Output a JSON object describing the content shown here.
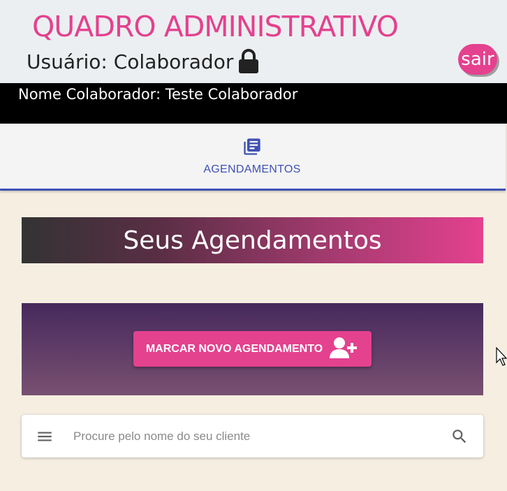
{
  "header": {
    "title": "QUADRO ADMINISTRATIVO",
    "user_label": "Usuário: Colaborador",
    "lock_icon": "lock-icon",
    "logout_label": "sair"
  },
  "collaborator": {
    "name_line": "Nome Colaborador: Teste Colaborador"
  },
  "tabs": [
    {
      "label": "AGENDAMENTOS",
      "icon": "library-books-icon",
      "active": true
    }
  ],
  "main": {
    "section_title": "Seus Agendamentos",
    "new_appointment_label": "MARCAR NOVO AGENDAMENTO",
    "new_appointment_icon": "person-add-icon"
  },
  "search": {
    "placeholder": "Procure pelo nome do seu cliente",
    "value": "",
    "menu_icon": "menu-icon",
    "search_icon": "search-icon"
  },
  "colors": {
    "brand_pink": "#e4418f",
    "tab_accent": "#3f51b5",
    "page_background": "#f6efe1"
  }
}
